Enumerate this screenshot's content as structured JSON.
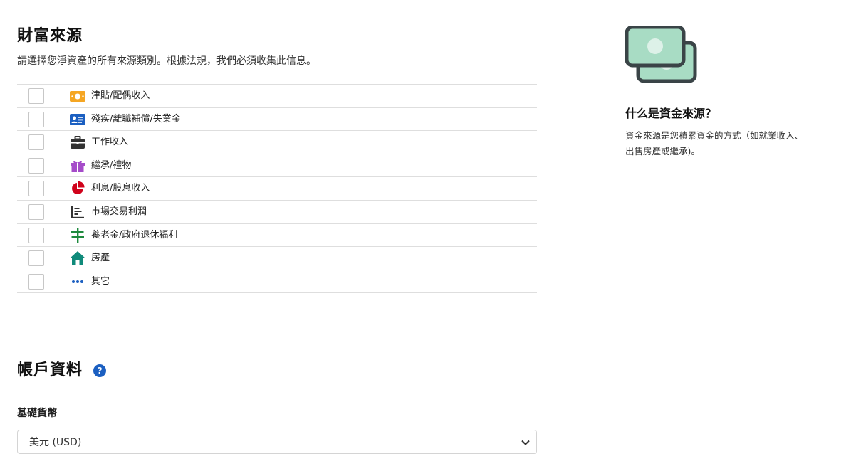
{
  "wealth": {
    "title": "財富來源",
    "description": "請選擇您淨資產的所有來源類別。根據法規，我們必須收集此信息。",
    "items": [
      {
        "label": "津貼/配偶收入",
        "icon": "money-bill-icon",
        "color": "#f5a623"
      },
      {
        "label": "殘疾/離職補償/失業金",
        "icon": "id-card-icon",
        "color": "#1b5fc1"
      },
      {
        "label": "工作收入",
        "icon": "briefcase-icon",
        "color": "#333333"
      },
      {
        "label": "繼承/禮物",
        "icon": "gift-icon",
        "color": "#a54bc9"
      },
      {
        "label": "利息/股息收入",
        "icon": "pie-chart-icon",
        "color": "#d0021b"
      },
      {
        "label": "市場交易利潤",
        "icon": "bar-chart-icon",
        "color": "#333333"
      },
      {
        "label": "養老金/政府退休福利",
        "icon": "signpost-icon",
        "color": "#1e8a3e"
      },
      {
        "label": "房產",
        "icon": "home-icon",
        "color": "#0f8a7a"
      },
      {
        "label": "其它",
        "icon": "ellipsis-icon",
        "color": "#1b5fc1"
      }
    ]
  },
  "account": {
    "title": "帳戶資料",
    "help": "?",
    "currency_label": "基礎貨幣",
    "currency_value": "美元 (USD)"
  },
  "info": {
    "title": "什么是資金來源？",
    "text": "資金來源是您積累資金的方式（如就業收入、出售房產或繼承)。"
  }
}
